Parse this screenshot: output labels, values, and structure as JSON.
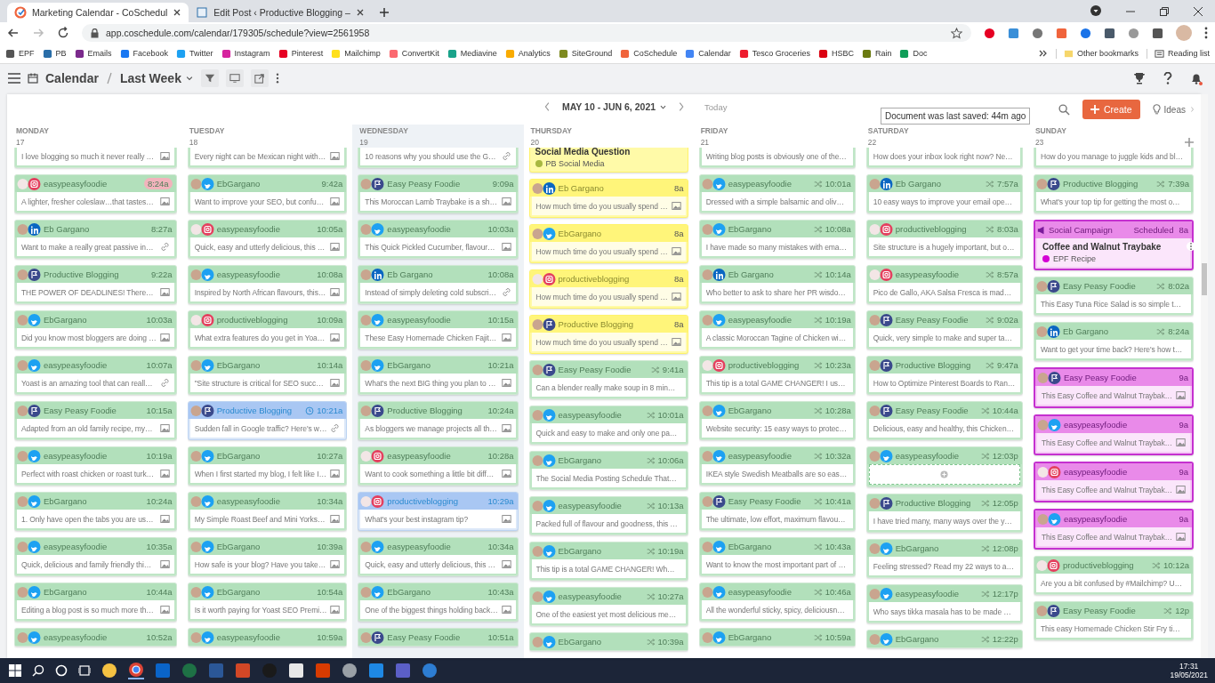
{
  "browser": {
    "tabs": [
      {
        "title": "Marketing Calendar - CoSchedul",
        "selected": true
      },
      {
        "title": "Edit Post ‹ Productive Blogging –",
        "selected": false
      }
    ],
    "address": "app.coschedule.com/calendar/179305/schedule?view=2561958",
    "bookmarks": [
      {
        "label": "EPF",
        "color": "#555555"
      },
      {
        "label": "PB",
        "color": "#2a6ea8"
      },
      {
        "label": "Emails",
        "color": "#7b2a8c"
      },
      {
        "label": "Facebook",
        "color": "#1877f2"
      },
      {
        "label": "Twitter",
        "color": "#1da1f2"
      },
      {
        "label": "Instagram",
        "color": "#d6249f"
      },
      {
        "label": "Pinterest",
        "color": "#e60023"
      },
      {
        "label": "Mailchimp",
        "color": "#ffe01b"
      },
      {
        "label": "ConvertKit",
        "color": "#fb6970"
      },
      {
        "label": "Mediavine",
        "color": "#1aa38a"
      },
      {
        "label": "Analytics",
        "color": "#f9ab00"
      },
      {
        "label": "SiteGround",
        "color": "#7e8a20"
      },
      {
        "label": "CoSchedule",
        "color": "#f0643c"
      },
      {
        "label": "Calendar",
        "color": "#4285f4"
      },
      {
        "label": "Tesco Groceries",
        "color": "#ee1c2e"
      },
      {
        "label": "HSBC",
        "color": "#db0011"
      },
      {
        "label": "Rain",
        "color": "#6a7a10"
      },
      {
        "label": "Doc",
        "color": "#0f9d58"
      }
    ],
    "other_bookmarks": "Other bookmarks",
    "reading_list": "Reading list"
  },
  "app": {
    "breadcrumb": [
      "Calendar",
      "Last Week"
    ],
    "date_range": "MAY 10 - JUN 6, 2021",
    "today": "Today",
    "create": "Create",
    "ideas": "Ideas",
    "tooltip": "Document was last saved: 44m ago"
  },
  "days": [
    {
      "name": "MONDAY",
      "date": "17",
      "today": false,
      "items": [
        {
          "kind": "snippet",
          "text": "I love blogging so much it never really …",
          "image": true
        },
        {
          "kind": "instagram",
          "color": "#b2e0bb",
          "account": "easypeasyfoodie",
          "time": "8:24a",
          "overdue": true,
          "text": "A lighter, fresher coleslaw…that tastes…",
          "image": true
        },
        {
          "kind": "linkedin",
          "color": "#b2e0bb",
          "account": "Eb Gargano",
          "time": "8:27a",
          "text": "Want to make a really great passive in…",
          "link": true
        },
        {
          "kind": "page",
          "color": "#b2e0bb",
          "account": "Productive Blogging",
          "time": "9:22a",
          "text": "THE POWER OF DEADLINES! There…",
          "image": true
        },
        {
          "kind": "twitter",
          "color": "#b2e0bb",
          "account": "EbGargano",
          "time": "10:03a",
          "text": "Did you know most bloggers are doing …",
          "image": true
        },
        {
          "kind": "twitter",
          "color": "#b2e0bb",
          "account": "easypeasyfoodie",
          "time": "10:07a",
          "text": "Yoast is an amazing tool that can reall…",
          "link": true
        },
        {
          "kind": "page",
          "color": "#b2e0bb",
          "account": "Easy Peasy Foodie",
          "time": "10:15a",
          "text": "Adapted from an old family recipe, my…",
          "image": true
        },
        {
          "kind": "twitter",
          "color": "#b2e0bb",
          "account": "easypeasyfoodie",
          "time": "10:19a",
          "text": "Perfect with roast chicken or roast turk…",
          "image": true
        },
        {
          "kind": "twitter",
          "color": "#b2e0bb",
          "account": "EbGargano",
          "time": "10:24a",
          "text": "1. Only have open the tabs you are us…",
          "image": true
        },
        {
          "kind": "twitter",
          "color": "#b2e0bb",
          "account": "easypeasyfoodie",
          "time": "10:35a",
          "text": "Quick, delicious and family friendly thi…",
          "image": true
        },
        {
          "kind": "twitter",
          "color": "#b2e0bb",
          "account": "EbGargano",
          "time": "10:44a",
          "text": "Editing a blog post is so much more th…",
          "image": true
        },
        {
          "kind": "twitter",
          "color": "#b2e0bb",
          "account": "easypeasyfoodie",
          "time": "10:52a"
        }
      ]
    },
    {
      "name": "TUESDAY",
      "date": "18",
      "today": false,
      "items": [
        {
          "kind": "snippet",
          "text": "Every night can be Mexican night with…",
          "image": true
        },
        {
          "kind": "twitter",
          "color": "#b2e0bb",
          "account": "EbGargano",
          "time": "9:42a",
          "text": "Want to improve your SEO, but confu…",
          "image": true
        },
        {
          "kind": "instagram",
          "color": "#b2e0bb",
          "account": "easypeasyfoodie",
          "time": "10:05a",
          "text": "Quick, easy and utterly delicious, this …",
          "image": true
        },
        {
          "kind": "twitter",
          "color": "#b2e0bb",
          "account": "easypeasyfoodie",
          "time": "10:08a",
          "text": "Inspired by North African flavours, this…",
          "image": true
        },
        {
          "kind": "instagram",
          "color": "#b2e0bb",
          "account": "productiveblogging",
          "time": "10:09a",
          "text": "What extra features do you get in Yoa…",
          "image": true
        },
        {
          "kind": "twitter",
          "color": "#b2e0bb",
          "account": "EbGargano",
          "time": "10:14a",
          "text": "\"Site structure is critical for SEO succ…",
          "image": true
        },
        {
          "kind": "page",
          "color": "#a9c7f3",
          "account": "Productive Blogging",
          "time": "10:21a",
          "clock": true,
          "text": "Sudden fall in Google traffic? Here's w…",
          "link": true
        },
        {
          "kind": "twitter",
          "color": "#b2e0bb",
          "account": "EbGargano",
          "time": "10:27a",
          "text": "When I first started my blog, I felt like I…",
          "image": true
        },
        {
          "kind": "twitter",
          "color": "#b2e0bb",
          "account": "easypeasyfoodie",
          "time": "10:34a",
          "text": "My Simple Roast Beef and Mini Yorks…",
          "image": true
        },
        {
          "kind": "twitter",
          "color": "#b2e0bb",
          "account": "EbGargano",
          "time": "10:39a",
          "text": "How safe is your blog? Have you take…",
          "image": true
        },
        {
          "kind": "twitter",
          "color": "#b2e0bb",
          "account": "EbGargano",
          "time": "10:54a",
          "text": "Is it worth paying for Yoast SEO Premi…",
          "image": true
        },
        {
          "kind": "twitter",
          "color": "#b2e0bb",
          "account": "easypeasyfoodie",
          "time": "10:59a"
        }
      ]
    },
    {
      "name": "WEDNESDAY",
      "date": "19",
      "today": true,
      "items": [
        {
          "kind": "snippet",
          "text": "10 reasons why you should use the G…",
          "link": true
        },
        {
          "kind": "page",
          "color": "#b2e0bb",
          "account": "Easy Peasy Foodie",
          "time": "9:09a",
          "text": "This Moroccan Lamb Traybake is a sh…",
          "image": true
        },
        {
          "kind": "twitter",
          "color": "#b2e0bb",
          "account": "easypeasyfoodie",
          "time": "10:03a",
          "text": "This Quick Pickled Cucumber, flavour…",
          "image": true
        },
        {
          "kind": "linkedin",
          "color": "#b2e0bb",
          "account": "Eb Gargano",
          "time": "10:08a",
          "text": "Instead of simply deleting cold subscri…",
          "link": true
        },
        {
          "kind": "twitter",
          "color": "#b2e0bb",
          "account": "easypeasyfoodie",
          "time": "10:15a",
          "text": "These Easy Homemade Chicken Fajit…",
          "image": true
        },
        {
          "kind": "twitter",
          "color": "#b2e0bb",
          "account": "EbGargano",
          "time": "10:21a",
          "text": "What's the next BIG thing you plan to …",
          "image": true
        },
        {
          "kind": "page",
          "color": "#b2e0bb",
          "account": "Productive Blogging",
          "time": "10:24a",
          "text": "As bloggers we manage projects all th…",
          "image": true
        },
        {
          "kind": "instagram",
          "color": "#b2e0bb",
          "account": "easypeasyfoodie",
          "time": "10:28a",
          "text": "Want to cook something a little bit diff…",
          "image": true
        },
        {
          "kind": "instagram",
          "color": "#a9c7f3",
          "account": "productiveblogging",
          "time": "10:29a",
          "text": "What's your best instagram tip?",
          "image": true
        },
        {
          "kind": "twitter",
          "color": "#b2e0bb",
          "account": "easypeasyfoodie",
          "time": "10:34a",
          "text": "Quick, easy and utterly delicious, this …",
          "image": true
        },
        {
          "kind": "twitter",
          "color": "#b2e0bb",
          "account": "EbGargano",
          "time": "10:43a",
          "text": "One of the biggest things holding back…",
          "image": true
        },
        {
          "kind": "page",
          "color": "#b2e0bb",
          "account": "Easy Peasy Foodie",
          "time": "10:51a"
        }
      ]
    },
    {
      "name": "THURSDAY",
      "date": "20",
      "today": false,
      "items": [
        {
          "kind": "campaign",
          "color": "#fffaa8",
          "title": "Social Media Question",
          "tag": {
            "label": "PB Social Media",
            "color": "#a8b840"
          }
        },
        {
          "kind": "linkedin",
          "color": "#fff57a",
          "account": "Eb Gargano",
          "time": "8a",
          "text": "How much time do you usually spend …",
          "image": true
        },
        {
          "kind": "twitter",
          "color": "#fff57a",
          "account": "EbGargano",
          "time": "8a",
          "text": "How much time do you usually spend …",
          "image": true
        },
        {
          "kind": "instagram",
          "color": "#fff57a",
          "account": "productiveblogging",
          "time": "8a",
          "text": "How much time do you usually spend …",
          "image": true
        },
        {
          "kind": "page",
          "color": "#fff57a",
          "account": "Productive Blogging",
          "time": "8a",
          "text": "How much time do you usually spend …",
          "image": true
        },
        {
          "kind": "page",
          "color": "#b2e0bb",
          "account": "Easy Peasy Foodie",
          "time": "9:41a",
          "repeat": true,
          "text": "Can a blender really make soup in 8 min…"
        },
        {
          "kind": "twitter",
          "color": "#b2e0bb",
          "account": "easypeasyfoodie",
          "time": "10:01a",
          "repeat": true,
          "text": "Quick and easy to make and only one pa…"
        },
        {
          "kind": "twitter",
          "color": "#b2e0bb",
          "account": "EbGargano",
          "time": "10:06a",
          "repeat": true,
          "text": "The Social Media Posting Schedule That…"
        },
        {
          "kind": "twitter",
          "color": "#b2e0bb",
          "account": "easypeasyfoodie",
          "time": "10:13a",
          "repeat": true,
          "text": "Packed full of flavour and goodness, this …"
        },
        {
          "kind": "twitter",
          "color": "#b2e0bb",
          "account": "EbGargano",
          "time": "10:19a",
          "repeat": true,
          "text": "This tip is a total GAME CHANGER! Wh…"
        },
        {
          "kind": "twitter",
          "color": "#b2e0bb",
          "account": "easypeasyfoodie",
          "time": "10:27a",
          "repeat": true,
          "text": "One of the easiest yet most delicious me…"
        },
        {
          "kind": "twitter",
          "color": "#b2e0bb",
          "account": "EbGargano",
          "time": "10:39a",
          "repeat": true
        }
      ]
    },
    {
      "name": "FRIDAY",
      "date": "21",
      "today": false,
      "items": [
        {
          "kind": "snippet",
          "text": "Writing blog posts is obviously one of the…"
        },
        {
          "kind": "twitter",
          "color": "#b2e0bb",
          "account": "easypeasyfoodie",
          "time": "10:01a",
          "repeat": true,
          "text": "Dressed with a simple balsamic and oliv…"
        },
        {
          "kind": "twitter",
          "color": "#b2e0bb",
          "account": "EbGargano",
          "time": "10:08a",
          "repeat": true,
          "text": "I have made so many mistakes with ema…"
        },
        {
          "kind": "linkedin",
          "color": "#b2e0bb",
          "account": "Eb Gargano",
          "time": "10:14a",
          "repeat": true,
          "text": "Who better to ask to share her PR wisdo…"
        },
        {
          "kind": "twitter",
          "color": "#b2e0bb",
          "account": "easypeasyfoodie",
          "time": "10:19a",
          "repeat": true,
          "text": "A classic Moroccan Tagine of Chicken wi…"
        },
        {
          "kind": "instagram",
          "color": "#b2e0bb",
          "account": "productiveblogging",
          "time": "10:23a",
          "repeat": true,
          "text": "This tip is a total GAME CHANGER! I us…"
        },
        {
          "kind": "twitter",
          "color": "#b2e0bb",
          "account": "EbGargano",
          "time": "10:28a",
          "repeat": true,
          "text": "Website security: 15 easy ways to protec…"
        },
        {
          "kind": "twitter",
          "color": "#b2e0bb",
          "account": "easypeasyfoodie",
          "time": "10:32a",
          "repeat": true,
          "text": "IKEA style Swedish Meatballs are so eas…"
        },
        {
          "kind": "page",
          "color": "#b2e0bb",
          "account": "Easy Peasy Foodie",
          "time": "10:41a",
          "repeat": true,
          "text": "The ultimate, low effort, maximum flavou…"
        },
        {
          "kind": "twitter",
          "color": "#b2e0bb",
          "account": "EbGargano",
          "time": "10:43a",
          "repeat": true,
          "text": "Want to know the most important part of …"
        },
        {
          "kind": "twitter",
          "color": "#b2e0bb",
          "account": "easypeasyfoodie",
          "time": "10:46a",
          "repeat": true,
          "text": "All the wonderful sticky, spicy, deliciousn…"
        },
        {
          "kind": "twitter",
          "color": "#b2e0bb",
          "account": "EbGargano",
          "time": "10:59a",
          "repeat": true
        }
      ]
    },
    {
      "name": "SATURDAY",
      "date": "22",
      "today": false,
      "items": [
        {
          "kind": "snippet",
          "text": "How does your inbox look right now? Ne…"
        },
        {
          "kind": "linkedin",
          "color": "#b2e0bb",
          "account": "Eb Gargano",
          "time": "7:57a",
          "repeat": true,
          "text": "10 easy ways to improve your email ope…"
        },
        {
          "kind": "instagram",
          "color": "#b2e0bb",
          "account": "productiveblogging",
          "time": "8:03a",
          "repeat": true,
          "text": "Site structure is a hugely important, but o…"
        },
        {
          "kind": "instagram",
          "color": "#b2e0bb",
          "account": "easypeasyfoodie",
          "time": "8:57a",
          "repeat": true,
          "text": "Pico de Gallo, AKA Salsa Fresca is mad…"
        },
        {
          "kind": "page",
          "color": "#b2e0bb",
          "account": "Easy Peasy Foodie",
          "time": "9:02a",
          "repeat": true,
          "text": "Quick, very simple to make and super ta…"
        },
        {
          "kind": "page",
          "color": "#b2e0bb",
          "account": "Productive Blogging",
          "time": "9:47a",
          "repeat": true,
          "text": "How to Optimize Pinterest Boards to Ran…"
        },
        {
          "kind": "page",
          "color": "#b2e0bb",
          "account": "Easy Peasy Foodie",
          "time": "10:44a",
          "repeat": true,
          "text": "Delicious, easy and healthy, this Chicken…"
        },
        {
          "kind": "twitter",
          "color": "#b2e0bb",
          "account": "easypeasyfoodie",
          "time": "12:03p",
          "repeat": true,
          "empty": true
        },
        {
          "kind": "page",
          "color": "#b2e0bb",
          "account": "Productive Blogging",
          "time": "12:05p",
          "repeat": true,
          "text": "I have tried many, many ways over the y…"
        },
        {
          "kind": "twitter",
          "color": "#b2e0bb",
          "account": "EbGargano",
          "time": "12:08p",
          "repeat": true,
          "text": "Feeling stressed? Read my 22 ways to a…"
        },
        {
          "kind": "twitter",
          "color": "#b2e0bb",
          "account": "easypeasyfoodie",
          "time": "12:17p",
          "repeat": true,
          "text": "Who says tikka masala has to be made …"
        },
        {
          "kind": "twitter",
          "color": "#b2e0bb",
          "account": "EbGargano",
          "time": "12:22p",
          "repeat": true
        }
      ]
    },
    {
      "name": "SUNDAY",
      "date": "23",
      "today": false,
      "add_button": true,
      "items": [
        {
          "kind": "snippet",
          "text": "How do you manage to juggle kids and bl…"
        },
        {
          "kind": "page",
          "color": "#b2e0bb",
          "account": "Productive Blogging",
          "time": "7:39a",
          "repeat": true,
          "text": "What's your top tip for getting the most o…"
        },
        {
          "kind": "campaign",
          "color": "#e98ae9",
          "label": "Social Campaign",
          "state_label": "Scheduled",
          "time": "8a",
          "title": "Coffee and Walnut Traybake",
          "tag": {
            "label": "EPF Recipe",
            "color": "#d400d4"
          },
          "menu": true
        },
        {
          "kind": "page",
          "color": "#b2e0bb",
          "account": "Easy Peasy Foodie",
          "time": "8:02a",
          "repeat": true,
          "text": "This Easy Tuna Rice Salad is so simple t…"
        },
        {
          "kind": "linkedin",
          "color": "#b2e0bb",
          "account": "Eb Gargano",
          "time": "8:24a",
          "repeat": true,
          "text": "Want to get your time back? Here's how t…"
        },
        {
          "kind": "page",
          "color": "#e98ae9",
          "account": "Easy Peasy Foodie",
          "time": "9a",
          "text": "This Easy Coffee and Walnut Traybak…",
          "image": true
        },
        {
          "kind": "twitter",
          "color": "#e98ae9",
          "account": "easypeasyfoodie",
          "time": "9a",
          "text": "This Easy Coffee and Walnut Traybak…",
          "image": true
        },
        {
          "kind": "instagram",
          "color": "#e98ae9",
          "account": "easypeasyfoodie",
          "time": "9a",
          "text": "This Easy Coffee and Walnut Traybak…",
          "image": true
        },
        {
          "kind": "twitter",
          "color": "#e98ae9",
          "account": "easypeasyfoodie",
          "time": "9a",
          "text": "This Easy Coffee and Walnut Traybak…",
          "image": true
        },
        {
          "kind": "instagram",
          "color": "#b2e0bb",
          "account": "productiveblogging",
          "time": "10:12a",
          "repeat": true,
          "text": "Are you a bit confused by #Mailchimp? U…"
        },
        {
          "kind": "page",
          "color": "#b2e0bb",
          "account": "Easy Peasy Foodie",
          "time": "12p",
          "repeat": true,
          "text": "This easy Homemade Chicken Stir Fry ti…"
        }
      ]
    }
  ],
  "taskbar": {
    "time": "17:31",
    "date": "19/05/2021"
  }
}
